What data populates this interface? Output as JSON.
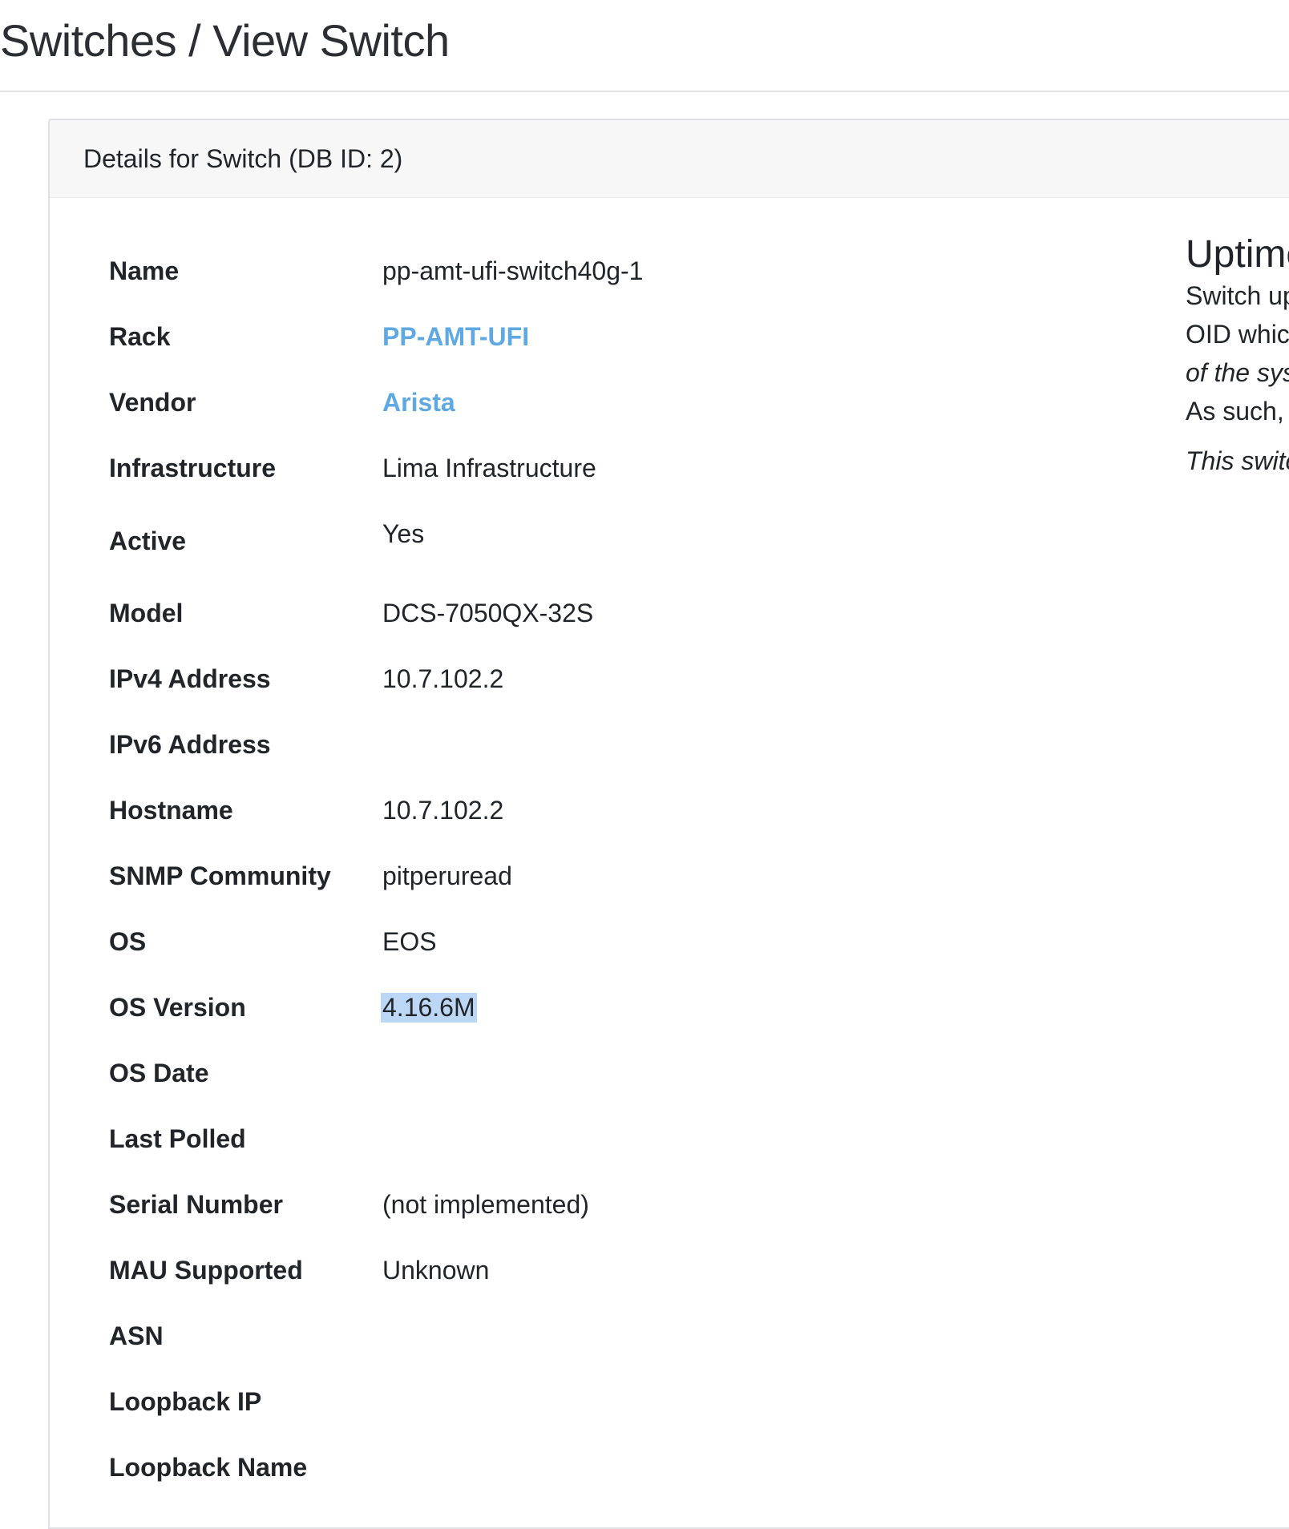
{
  "header": {
    "title": "Switches / View Switch"
  },
  "card": {
    "title": "Details for Switch (DB ID: 2)"
  },
  "details": [
    {
      "label": "Name",
      "value": "pp-amt-ufi-switch40g-1"
    },
    {
      "label": "Rack",
      "value": "PP-AMT-UFI",
      "link": true
    },
    {
      "label": "Vendor",
      "value": "Arista",
      "link": true
    },
    {
      "label": "Infrastructure",
      "value": "Lima Infrastructure"
    },
    {
      "label": "Active",
      "value": "Yes"
    },
    {
      "label": "Model",
      "value": "DCS-7050QX-32S"
    },
    {
      "label": "IPv4 Address",
      "value": "10.7.102.2"
    },
    {
      "label": "IPv6 Address",
      "value": ""
    },
    {
      "label": "Hostname",
      "value": "10.7.102.2"
    },
    {
      "label": "SNMP Community",
      "value": "pitperuread"
    },
    {
      "label": "OS",
      "value": "EOS"
    },
    {
      "label": "OS Version",
      "value": "4.16.6M",
      "selected": true
    },
    {
      "label": "OS Date",
      "value": ""
    },
    {
      "label": "Last Polled",
      "value": ""
    },
    {
      "label": "Serial Number",
      "value": "(not implemented)"
    },
    {
      "label": "MAU Supported",
      "value": "Unknown"
    },
    {
      "label": "ASN",
      "value": ""
    },
    {
      "label": "Loopback IP",
      "value": ""
    },
    {
      "label": "Loopback Name",
      "value": ""
    }
  ],
  "uptime": {
    "heading": "Uptime",
    "line1": "Switch up",
    "line2": "OID whic",
    "line3": "of the sys",
    "line4": "As such,",
    "note": "This switc"
  },
  "colors": {
    "link": "#5ea9e3",
    "selection": "#bcd6f5",
    "card_header_bg": "#f7f7f7"
  }
}
